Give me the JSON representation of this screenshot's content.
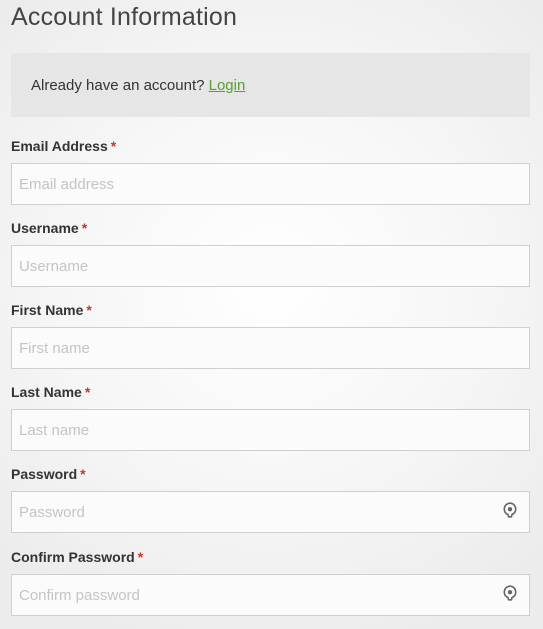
{
  "page": {
    "title": "Account Information"
  },
  "login_banner": {
    "text": "Already have an account?",
    "link_label": "Login"
  },
  "form": {
    "required_marker": "*",
    "fields": [
      {
        "label": "Email Address",
        "placeholder": "Email address",
        "value": ""
      },
      {
        "label": "Username",
        "placeholder": "Username",
        "value": ""
      },
      {
        "label": "First Name",
        "placeholder": "First name",
        "value": ""
      },
      {
        "label": "Last Name",
        "placeholder": "Last name",
        "value": ""
      },
      {
        "label": "Password",
        "placeholder": "Password",
        "value": "",
        "icon": "eye-icon"
      },
      {
        "label": "Confirm Password",
        "placeholder": "Confirm password",
        "value": "",
        "icon": "eye-icon"
      }
    ]
  },
  "colors": {
    "link": "#5a9e2f",
    "required": "#c0392b",
    "banner_bg": "#e6e6e6"
  }
}
